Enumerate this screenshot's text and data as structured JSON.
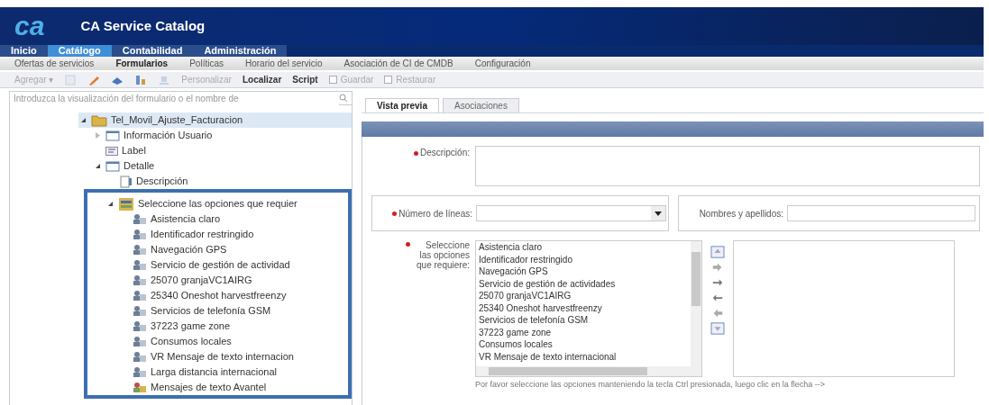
{
  "header": {
    "logo": "ca",
    "title": "CA Service Catalog"
  },
  "main_tabs": [
    {
      "label": "Inicio",
      "selected": false
    },
    {
      "label": "Catálogo",
      "selected": true
    },
    {
      "label": "Contabilidad",
      "selected": false
    },
    {
      "label": "Administración",
      "selected": false
    }
  ],
  "sub_nav": [
    {
      "label": "Ofertas de servicios",
      "selected": false
    },
    {
      "label": "Formularios",
      "selected": true
    },
    {
      "label": "Políticas",
      "selected": false
    },
    {
      "label": "Horario del servicio",
      "selected": false
    },
    {
      "label": "Asociación de CI de CMDB",
      "selected": false
    },
    {
      "label": "Configuración",
      "selected": false
    }
  ],
  "toolbar": [
    {
      "kind": "dropdown",
      "label": "Agregar ▾",
      "disabled": true
    },
    {
      "kind": "icon",
      "disabled": true
    },
    {
      "kind": "icon",
      "disabled": false
    },
    {
      "kind": "icon",
      "disabled": false
    },
    {
      "kind": "icon",
      "disabled": false
    },
    {
      "kind": "icon",
      "disabled": true
    },
    {
      "kind": "button",
      "label": "Personalizar",
      "disabled": true
    },
    {
      "kind": "button",
      "label": "Localizar",
      "disabled": false
    },
    {
      "kind": "button",
      "label": "Script",
      "disabled": false
    },
    {
      "kind": "icon-button",
      "label": "Guardar",
      "disabled": true
    },
    {
      "kind": "icon-button",
      "label": "Restaurar",
      "disabled": true
    }
  ],
  "tree_panel": {
    "search": {
      "placeholder": "Introduzca la visualización del formulario o el nombre de"
    },
    "tree": [
      {
        "label": "Tel_Movil_Ajuste_Facturacion",
        "kind": "form",
        "expanded": true,
        "selected": true,
        "children": [
          {
            "label": "Información Usuario",
            "kind": "section",
            "expanded": false,
            "selected": false
          },
          {
            "label": "Label",
            "kind": "label",
            "selected": false
          },
          {
            "label": "Detalle",
            "kind": "section",
            "expanded": true,
            "selected": false,
            "children": [
              {
                "label": "Descripción",
                "kind": "field",
                "selected": false
              },
              {
                "label": "Seleccione las opciones que requier",
                "kind": "list",
                "expanded": true,
                "selected": false,
                "annotated": true,
                "children": [
                  {
                    "label": "Asistencia claro",
                    "kind": "option",
                    "selected": false
                  },
                  {
                    "label": "Identificador restringido",
                    "kind": "option",
                    "selected": false
                  },
                  {
                    "label": "Navegación GPS",
                    "kind": "option",
                    "selected": false
                  },
                  {
                    "label": "Servicio de gestión de actividad",
                    "kind": "option",
                    "selected": false
                  },
                  {
                    "label": "25070 granjaVC1AIRG",
                    "kind": "option",
                    "selected": false
                  },
                  {
                    "label": "25340 Oneshot harvestfreenzy",
                    "kind": "option",
                    "selected": false
                  },
                  {
                    "label": "Servicios de telefonía GSM",
                    "kind": "option",
                    "selected": false
                  },
                  {
                    "label": "37223 game zone",
                    "kind": "option",
                    "selected": false
                  },
                  {
                    "label": "Consumos locales",
                    "kind": "option",
                    "selected": false
                  },
                  {
                    "label": "VR Mensaje de texto internacion",
                    "kind": "option",
                    "selected": false
                  },
                  {
                    "label": "Larga distancia internacional",
                    "kind": "option",
                    "selected": false
                  },
                  {
                    "label": "Mensajes de texto Avantel",
                    "kind": "option-alt",
                    "selected": false
                  }
                ]
              }
            ]
          }
        ]
      }
    ]
  },
  "preview": {
    "tabs": [
      {
        "label": "Vista previa",
        "selected": true
      },
      {
        "label": "Asociaciones",
        "selected": false
      }
    ],
    "description": {
      "label": "Descripción:",
      "required": true
    },
    "lines": {
      "label": "Número de líneas:",
      "required": true
    },
    "names": {
      "label": "Nombres y apellidos:",
      "required": false
    },
    "options": {
      "label": "Seleccione las opciones que requiere:",
      "required": true,
      "available": [
        "Asistencia claro",
        "Identificador restringido",
        "Navegación GPS",
        "Servicio de gestión de actividades",
        "25070 granjaVC1AIRG",
        "25340 Oneshot harvestfreenzy",
        "Servicios de telefonía GSM",
        "37223 game zone",
        "Consumos locales",
        "VR Mensaje de texto internacional"
      ],
      "help": "Por favor seleccione las opciones manteniendo la tecla Ctrl presionada, luego clic en la flecha -->"
    }
  }
}
